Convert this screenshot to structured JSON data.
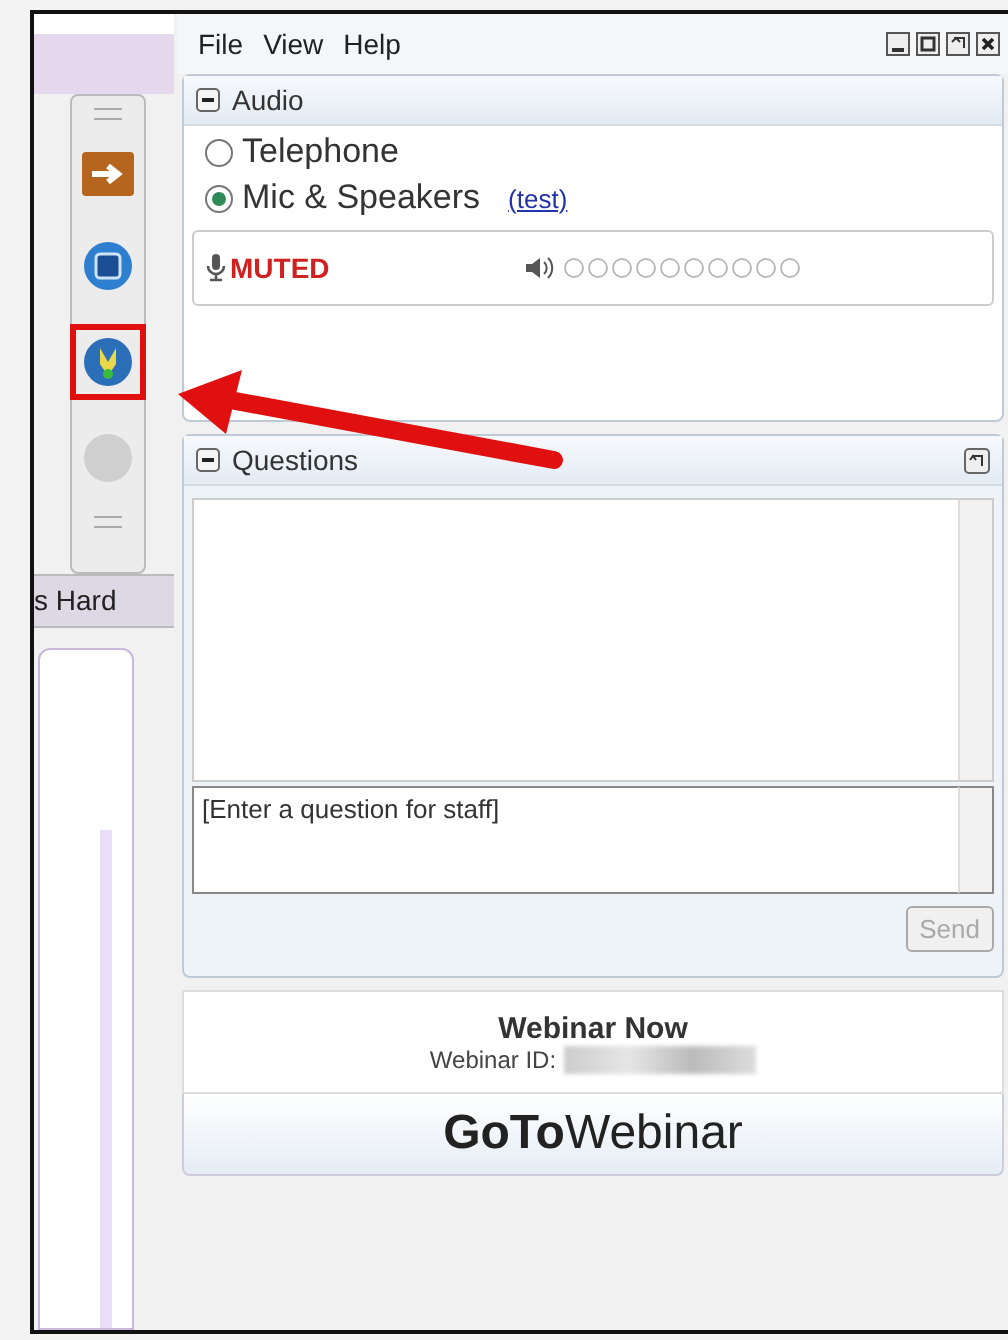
{
  "menu": [
    "File",
    "View",
    "Help"
  ],
  "side_tab": "s Hard",
  "toolbar": [
    {
      "kind": "exit",
      "highlighted": false
    },
    {
      "kind": "screen",
      "highlighted": false
    },
    {
      "kind": "audio",
      "highlighted": true
    },
    {
      "kind": "blank",
      "highlighted": false
    }
  ],
  "audio": {
    "title": "Audio",
    "expanded": true,
    "options": [
      {
        "label": "Telephone",
        "selected": false
      },
      {
        "label": "Mic & Speakers",
        "selected": true
      }
    ],
    "test_link": "(test)",
    "mic_status": "MUTED"
  },
  "questions": {
    "title": "Questions",
    "expanded": true,
    "placeholder": "[Enter a question for staff]",
    "send": {
      "label": "Send",
      "disabled": true
    }
  },
  "info": {
    "title": "Webinar Now",
    "id_label": "Webinar ID:"
  },
  "logo": "**GoTo**Webinar"
}
